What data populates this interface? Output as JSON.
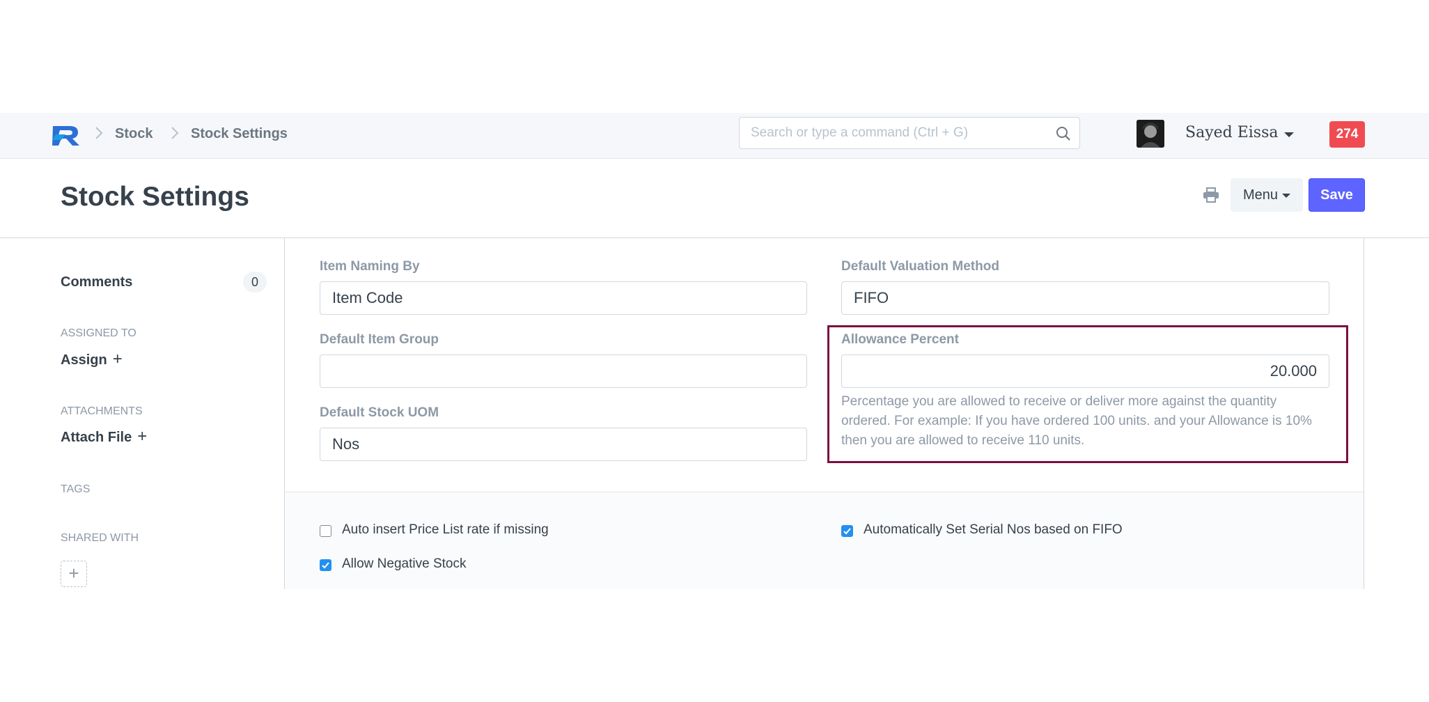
{
  "navbar": {
    "breadcrumbs": [
      "Stock",
      "Stock Settings"
    ],
    "search_placeholder": "Search or type a command (Ctrl + G)",
    "user_name": "Sayed Eissa",
    "notification_count": "274"
  },
  "page": {
    "title": "Stock Settings",
    "menu_label": "Menu",
    "save_label": "Save"
  },
  "sidebar": {
    "comments_label": "Comments",
    "comments_count": "0",
    "assigned_to_label": "ASSIGNED TO",
    "assign_label": "Assign",
    "attachments_label": "ATTACHMENTS",
    "attach_file_label": "Attach File",
    "tags_label": "TAGS",
    "shared_with_label": "SHARED WITH"
  },
  "form": {
    "item_naming_by": {
      "label": "Item Naming By",
      "value": "Item Code"
    },
    "default_item_group": {
      "label": "Default Item Group",
      "value": ""
    },
    "default_stock_uom": {
      "label": "Default Stock UOM",
      "value": "Nos"
    },
    "default_valuation_method": {
      "label": "Default Valuation Method",
      "value": "FIFO"
    },
    "allowance_percent": {
      "label": "Allowance Percent",
      "value": "20.000",
      "help": "Percentage you are allowed to receive or deliver more against the quantity ordered. For example: If you have ordered 100 units. and your Allowance is 10% then you are allowed to receive 110 units."
    },
    "highlight_color": "#7a1040",
    "checkboxes": [
      {
        "label": "Auto insert Price List rate if missing",
        "checked": false
      },
      {
        "label": "Allow Negative Stock",
        "checked": true
      },
      {
        "label": "Automatically Set Serial Nos based on FIFO",
        "checked": true
      }
    ]
  },
  "colors": {
    "primary": "#5e64ff",
    "badge": "#f04b51",
    "checkbox": "#2490ef"
  }
}
